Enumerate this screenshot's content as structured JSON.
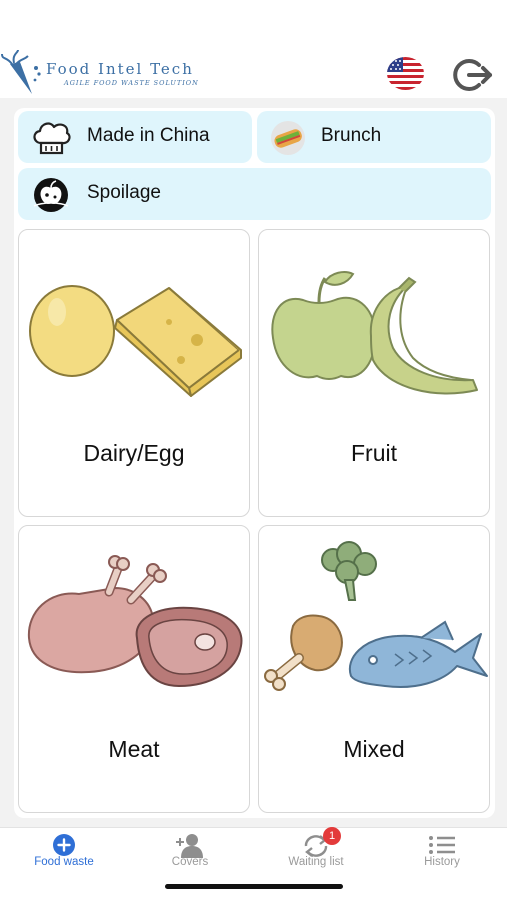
{
  "header": {
    "logo_title": "Food Intel Tech",
    "logo_subtitle": "AGILE FOOD WASTE SOLUTION",
    "language_flag_icon": "us-flag-icon",
    "logout_icon": "logout-icon"
  },
  "chips": [
    {
      "label": "Made in China",
      "icon": "chef-hat-icon"
    },
    {
      "label": "Brunch",
      "icon": "sandwich-icon"
    },
    {
      "label": "Spoilage",
      "icon": "rotten-apple-icon"
    }
  ],
  "categories": [
    {
      "label": "Dairy/Egg",
      "icon": "egg-cheese-icon"
    },
    {
      "label": "Fruit",
      "icon": "apple-banana-icon"
    },
    {
      "label": "Meat",
      "icon": "chicken-steak-icon"
    },
    {
      "label": "Mixed",
      "icon": "mixed-food-icon"
    }
  ],
  "tabs": [
    {
      "label": "Food waste",
      "icon": "plus-circle-icon",
      "active": true
    },
    {
      "label": "Covers",
      "icon": "add-user-icon",
      "active": false
    },
    {
      "label": "Waiting list",
      "icon": "sync-icon",
      "badge": "1",
      "active": false
    },
    {
      "label": "History",
      "icon": "list-icon",
      "active": false
    }
  ],
  "colors": {
    "accent": "#2f6fd6",
    "chip_bg": "#dff5fc",
    "badge": "#e33b3b",
    "logo": "#3c6fa4"
  }
}
